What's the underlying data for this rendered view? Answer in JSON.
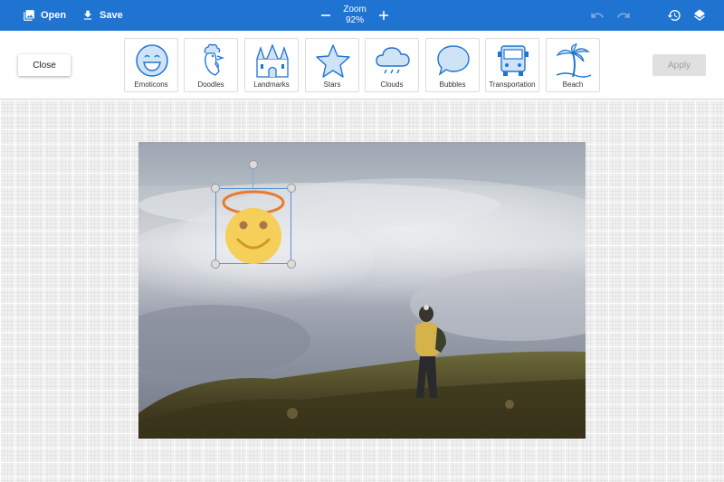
{
  "topbar": {
    "open_label": "Open",
    "save_label": "Save",
    "zoom_label": "Zoom",
    "zoom_value": "92%",
    "icons": [
      "open-image-icon",
      "download-icon",
      "minus-icon",
      "plus-icon",
      "undo-icon",
      "redo-icon",
      "history-icon",
      "layers-icon"
    ]
  },
  "toolbar": {
    "close_label": "Close",
    "apply_label": "Apply",
    "categories": [
      {
        "label": "Emoticons",
        "icon": "smiley-icon"
      },
      {
        "label": "Doodles",
        "icon": "rooster-icon"
      },
      {
        "label": "Landmarks",
        "icon": "castle-icon"
      },
      {
        "label": "Stars",
        "icon": "star-icon"
      },
      {
        "label": "Clouds",
        "icon": "cloud-icon"
      },
      {
        "label": "Bubbles",
        "icon": "speech-bubble-icon"
      },
      {
        "label": "Transportation",
        "icon": "bus-icon"
      },
      {
        "label": "Beach",
        "icon": "palm-tree-icon"
      }
    ]
  },
  "colors": {
    "topbar": "#1f74d2",
    "icon_blue": "#1f74d2",
    "icon_fill": "#cfe3f7",
    "sticker_face": "#f6cf5a",
    "sticker_halo": "#e87a2e"
  }
}
